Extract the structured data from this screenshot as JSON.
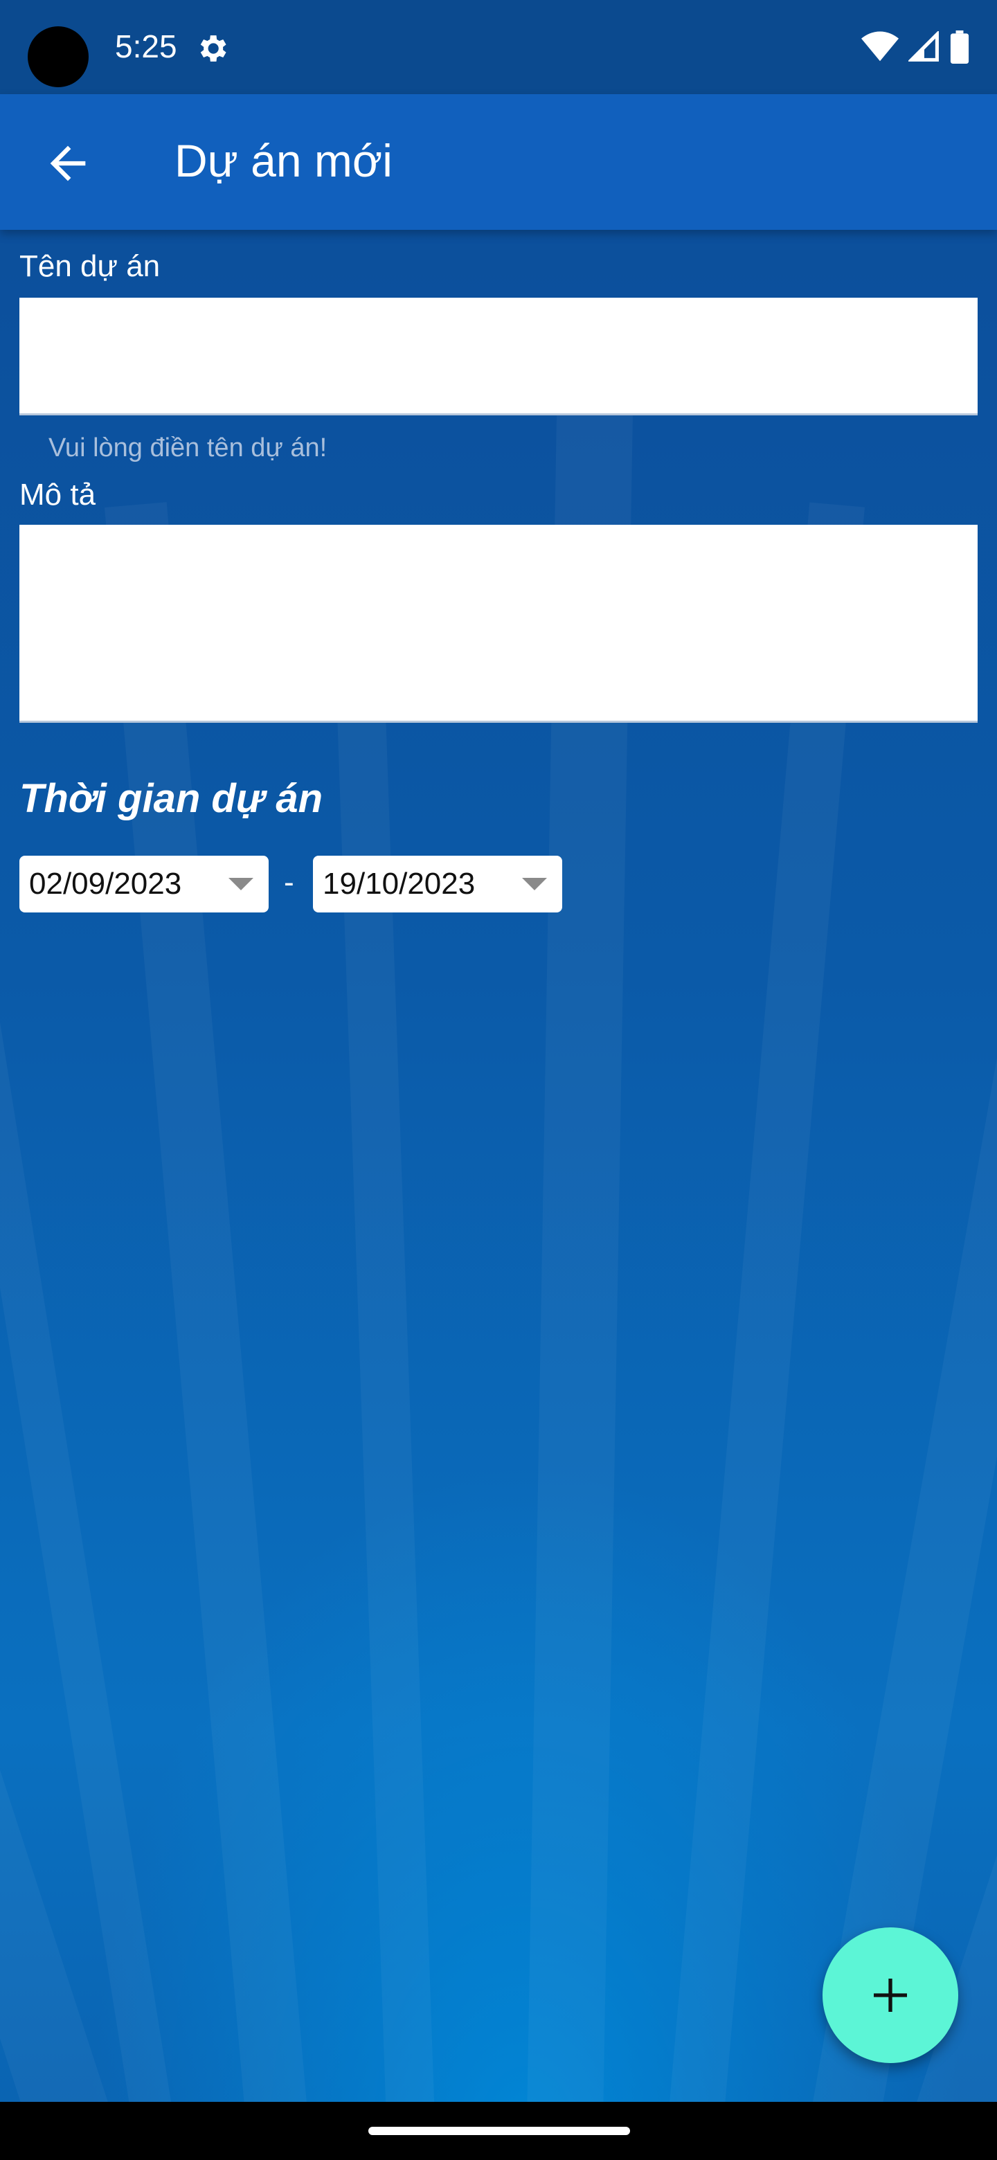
{
  "status_bar": {
    "time": "5:25",
    "icons": [
      "settings-gear-icon",
      "wifi-icon",
      "cell-signal-icon",
      "battery-icon"
    ]
  },
  "app_bar": {
    "title": "Dự án mới",
    "back_icon": "arrow-back-icon"
  },
  "form": {
    "name_label": "Tên dự án",
    "name_value": "",
    "name_helper": "Vui lòng điền tên dự án!",
    "description_label": "Mô tả",
    "description_value": "",
    "period_title": "Thời gian dự án",
    "start_date": "02/09/2023",
    "separator": "-",
    "end_date": "19/10/2023"
  },
  "fab": {
    "icon": "plus-icon"
  },
  "colors": {
    "status_bar": "#0b4a8f",
    "app_bar": "#1160bd",
    "fab": "#5cf5d6",
    "helper_text": "#a9bfdc"
  }
}
